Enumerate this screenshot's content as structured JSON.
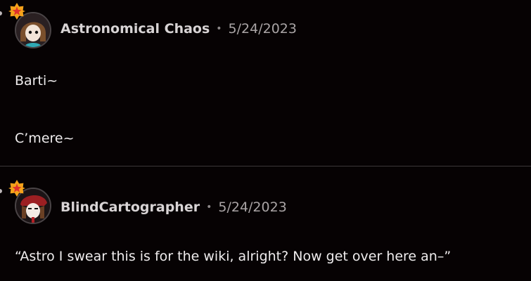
{
  "comments": [
    {
      "author": "Astronomical Chaos",
      "separator": "•",
      "date": "5/24/2023",
      "lines": [
        "Barti~",
        "C’mere~"
      ]
    },
    {
      "author": "BlindCartographer",
      "separator": "•",
      "date": "5/24/2023",
      "lines": [
        "“Astro I swear this is for the wiki, alright? Now get over here an–”"
      ]
    }
  ],
  "icons": {
    "badge": "star-badge-icon",
    "avatar": "avatar-image"
  },
  "colors": {
    "background": "#060203",
    "badge": "#f5a21b",
    "badge_star": "#e0312c",
    "divider": "#3b3738"
  }
}
